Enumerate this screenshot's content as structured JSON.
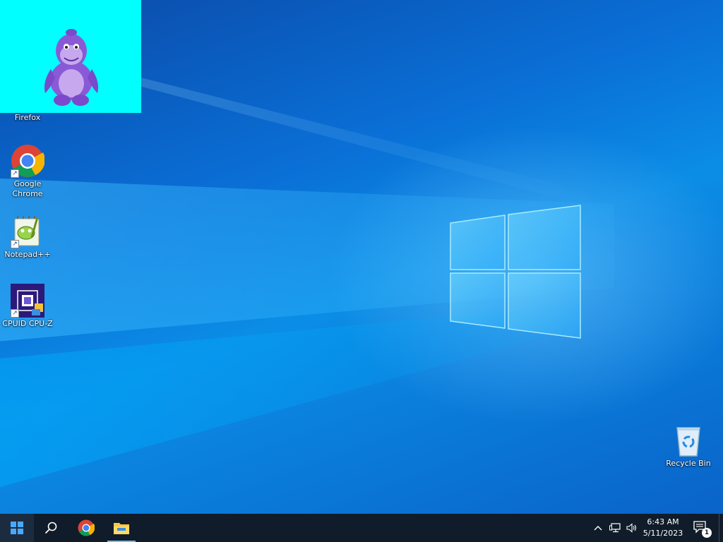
{
  "desktop": {
    "icons": [
      {
        "label": "Firefox",
        "icon": "firefox-icon"
      },
      {
        "label": "Google Chrome",
        "icon": "chrome-icon"
      },
      {
        "label": "Notepad++",
        "icon": "notepadpp-icon"
      },
      {
        "label": "CPUID CPU-Z",
        "icon": "cpuz-icon"
      },
      {
        "label": "Recycle Bin",
        "icon": "recycle-bin-icon"
      }
    ],
    "overlay_window": {
      "background": "#00ffff",
      "icon": "purple-gorilla-icon"
    }
  },
  "taskbar": {
    "start_icon": "windows-start-icon",
    "search_icon": "search-icon",
    "pinned": [
      "chrome-icon",
      "file-explorer-icon"
    ],
    "tray": {
      "icons": [
        "chevron-up-icon",
        "network-icon",
        "volume-icon"
      ],
      "time": "6:43 AM",
      "date": "5/11/2023",
      "notifications_count": "1"
    }
  },
  "colors": {
    "taskbar": "#101c2a",
    "desktop_accent": "#0a78d7",
    "overlay": "#00ffff"
  }
}
